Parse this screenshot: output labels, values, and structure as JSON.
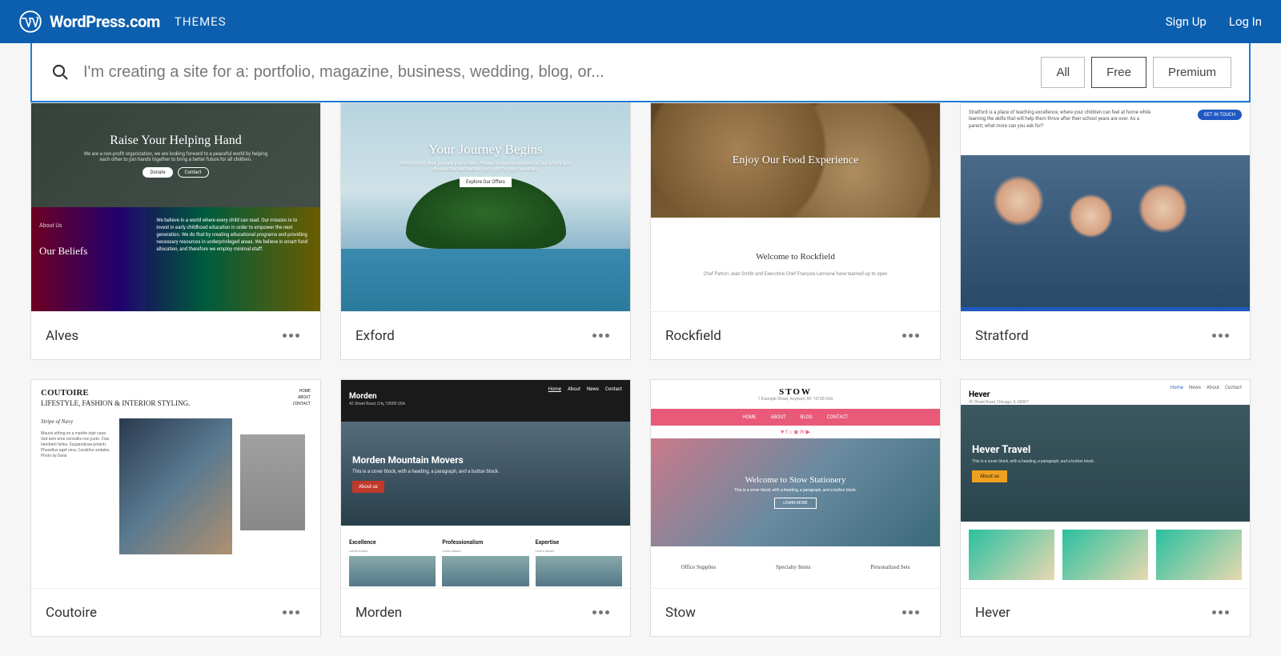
{
  "header": {
    "brand": "WordPress.com",
    "section": "THEMES",
    "signup": "Sign Up",
    "login": "Log In"
  },
  "search": {
    "placeholder": "I'm creating a site for a: portfolio, magazine, business, wedding, blog, or...",
    "value": ""
  },
  "filters": {
    "all": "All",
    "free": "Free",
    "premium": "Premium",
    "active": "free"
  },
  "themes": [
    {
      "name": "Alves",
      "preview": {
        "hero_title": "Raise Your Helping Hand",
        "hero_sub": "We are a non-profit organization, we are looking forward to a peaceful world by helping each other to join hands together to bring a better future for all children.",
        "btn1": "Donate",
        "btn2": "Contact",
        "about": "About Us",
        "beliefs": "Our Beliefs",
        "belief_text": "We believe in a world where every child can read. Our mission is to invest in early childhood education in order to empower the next generation. We do that by creating educational programs and providing necessary resources in underprivileged areas. We believe in smart fund allocation, and therefore we employ minimal staff."
      }
    },
    {
      "name": "Exford",
      "preview": {
        "title": "Your Journey Begins",
        "sub": "With Exford, your journey starts here. Please be sure to explore all our offers and choose the destination just right for your vacation.",
        "cta": "Explore Our Offers"
      }
    },
    {
      "name": "Rockfield",
      "preview": {
        "hero": "Enjoy Our Food Experience",
        "welcome": "Welcome to Rockfield",
        "blurb": "Chef Patron Jean Smith and Executive Chef François Lemoine have teamed up to open"
      }
    },
    {
      "name": "Stratford",
      "preview": {
        "blurb": "Stratford is a place of teaching excellence, where your children can feel at home while learning the skills that will help them thrive after their school years are over. As a parent, what more can you ask for?",
        "cta": "GET IN TOUCH"
      }
    },
    {
      "name": "Coutoire",
      "preview": {
        "logo": "COUTOIRE",
        "tagline": "LIFESTYLE, FASHION & INTERIOR STYLING.",
        "nav": [
          "HOME",
          "ABOUT",
          "CONTACT"
        ],
        "caption": "Stripe of Navy",
        "body": "Mauris sitting on a marble stair case. Sed sem eros convallis non justo. Cras hendrerit tellus. Suspendisse potenti. Phasellus eget urna. Curabitur sodales. Photo by Daria"
      }
    },
    {
      "name": "Morden",
      "preview": {
        "brand": "Morden",
        "addr": "42 Street Road, City, 10000 USA",
        "nav": [
          "Home",
          "About",
          "News",
          "Contact"
        ],
        "hero": "Morden Mountain Movers",
        "sub": "This is a cover block, with a heading, a paragraph, and a button block.",
        "cta": "About us",
        "cols": [
          "Excellence",
          "Professionalism",
          "Expertise"
        ]
      }
    },
    {
      "name": "Stow",
      "preview": {
        "brand": "STOW",
        "addr": "1 Example Street, Anytown, NY 10100 USA",
        "tabs": [
          "HOME",
          "ABOUT",
          "BLOG",
          "CONTACT"
        ],
        "hero": "Welcome to Stow Stationery",
        "sub": "This is a cover block, with a heading, a paragraph, and a button block.",
        "cta": "LEARN MORE",
        "foot": [
          "Office Supplies",
          "Specialty Items",
          "Personalized Sets"
        ]
      }
    },
    {
      "name": "Hever",
      "preview": {
        "brand": "Hever",
        "addr": "42 Street Road, Chicago, IL 60007",
        "nav": [
          "Home",
          "News",
          "About",
          "Contact"
        ],
        "hero": "Hever Travel",
        "sub": "This is a cover block, with a heading, a paragraph, and a button block.",
        "cta": "About us"
      }
    }
  ]
}
